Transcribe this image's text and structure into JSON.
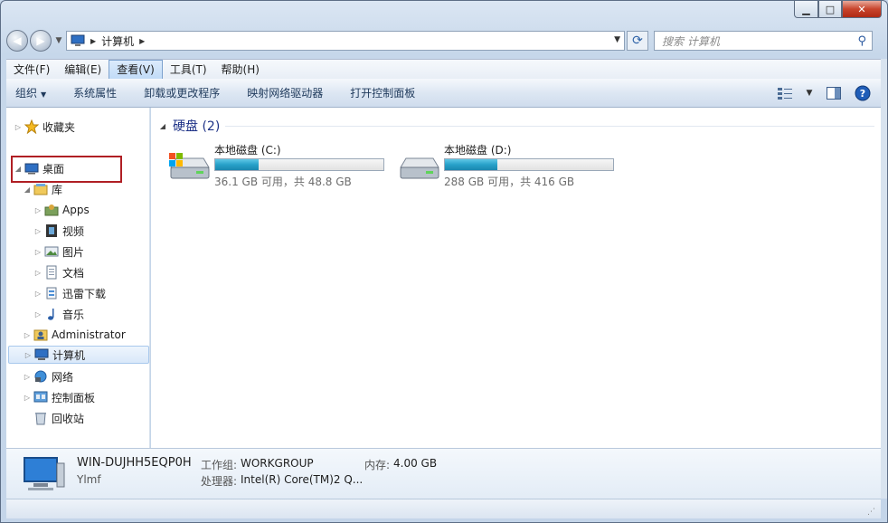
{
  "window": {
    "minimize_glyph": "▁",
    "maximize_glyph": "□",
    "close_glyph": "✕"
  },
  "address_bar": {
    "crumb": "计算机",
    "search_placeholder": "搜索 计算机"
  },
  "menubar": [
    {
      "label": "文件(F)"
    },
    {
      "label": "编辑(E)"
    },
    {
      "label": "查看(V)",
      "active": true
    },
    {
      "label": "工具(T)"
    },
    {
      "label": "帮助(H)"
    }
  ],
  "toolbar": {
    "organize": "组织",
    "items": [
      "系统属性",
      "卸载或更改程序",
      "映射网络驱动器",
      "打开控制面板"
    ]
  },
  "nav": {
    "favorites": "收藏夹",
    "desktop": "桌面",
    "libraries": "库",
    "lib_items": [
      "Apps",
      "视频",
      "图片",
      "文档",
      "迅雷下载",
      "音乐"
    ],
    "administrator": "Administrator",
    "computer": "计算机",
    "network": "网络",
    "control_panel": "控制面板",
    "recycle_bin": "回收站"
  },
  "content": {
    "group_header": "硬盘 (2)",
    "drives": [
      {
        "name": "本地磁盘 (C:)",
        "info": "36.1 GB 可用，共 48.8 GB",
        "used_fraction": 0.26
      },
      {
        "name": "本地磁盘 (D:)",
        "info": "288 GB 可用，共 416 GB",
        "used_fraction": 0.31
      }
    ]
  },
  "details": {
    "computer_name": "WIN-DUJHH5EQP0H",
    "owner": "Ylmf",
    "workgroup_label": "工作组:",
    "workgroup": "WORKGROUP",
    "memory_label": "内存:",
    "memory": "4.00 GB",
    "processor_label": "处理器:",
    "processor": "Intel(R) Core(TM)2 Q..."
  },
  "colors": {
    "selection_border": "#b01f24",
    "drive_fill": "#27a1c9",
    "header_text": "#1e3287"
  }
}
